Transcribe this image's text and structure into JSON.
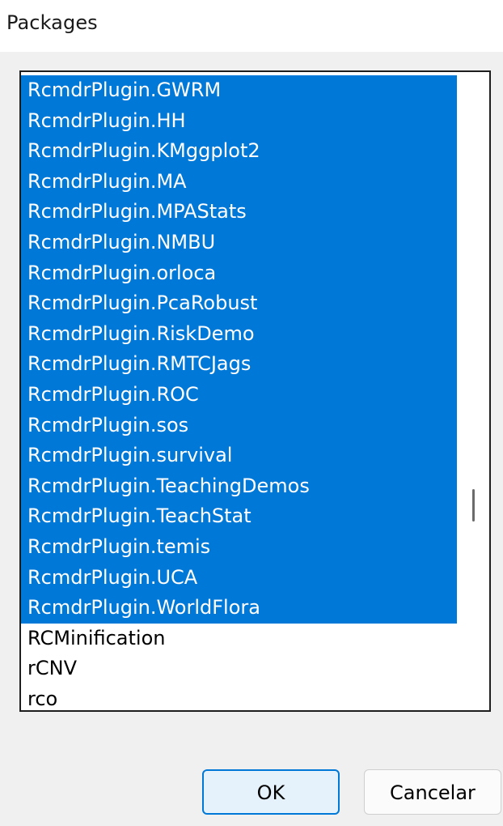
{
  "dialog": {
    "title": "Packages"
  },
  "packages": {
    "items": [
      {
        "label": "RcmdrPlugin.GWRM",
        "selected": true
      },
      {
        "label": "RcmdrPlugin.HH",
        "selected": true
      },
      {
        "label": "RcmdrPlugin.KMggplot2",
        "selected": true
      },
      {
        "label": "RcmdrPlugin.MA",
        "selected": true
      },
      {
        "label": "RcmdrPlugin.MPAStats",
        "selected": true
      },
      {
        "label": "RcmdrPlugin.NMBU",
        "selected": true
      },
      {
        "label": "RcmdrPlugin.orloca",
        "selected": true
      },
      {
        "label": "RcmdrPlugin.PcaRobust",
        "selected": true
      },
      {
        "label": "RcmdrPlugin.RiskDemo",
        "selected": true
      },
      {
        "label": "RcmdrPlugin.RMTCJags",
        "selected": true
      },
      {
        "label": "RcmdrPlugin.ROC",
        "selected": true
      },
      {
        "label": "RcmdrPlugin.sos",
        "selected": true
      },
      {
        "label": "RcmdrPlugin.survival",
        "selected": true
      },
      {
        "label": "RcmdrPlugin.TeachingDemos",
        "selected": true
      },
      {
        "label": "RcmdrPlugin.TeachStat",
        "selected": true
      },
      {
        "label": "RcmdrPlugin.temis",
        "selected": true
      },
      {
        "label": "RcmdrPlugin.UCA",
        "selected": true
      },
      {
        "label": "RcmdrPlugin.WorldFlora",
        "selected": true
      },
      {
        "label": "RCMinification",
        "selected": false
      },
      {
        "label": "rCNV",
        "selected": false
      },
      {
        "label": "rco",
        "selected": false
      }
    ]
  },
  "buttons": {
    "ok_label": "OK",
    "cancel_label": "Cancelar"
  },
  "colors": {
    "selection": "#0078d7",
    "dialog_bg": "#f0f0f0"
  }
}
